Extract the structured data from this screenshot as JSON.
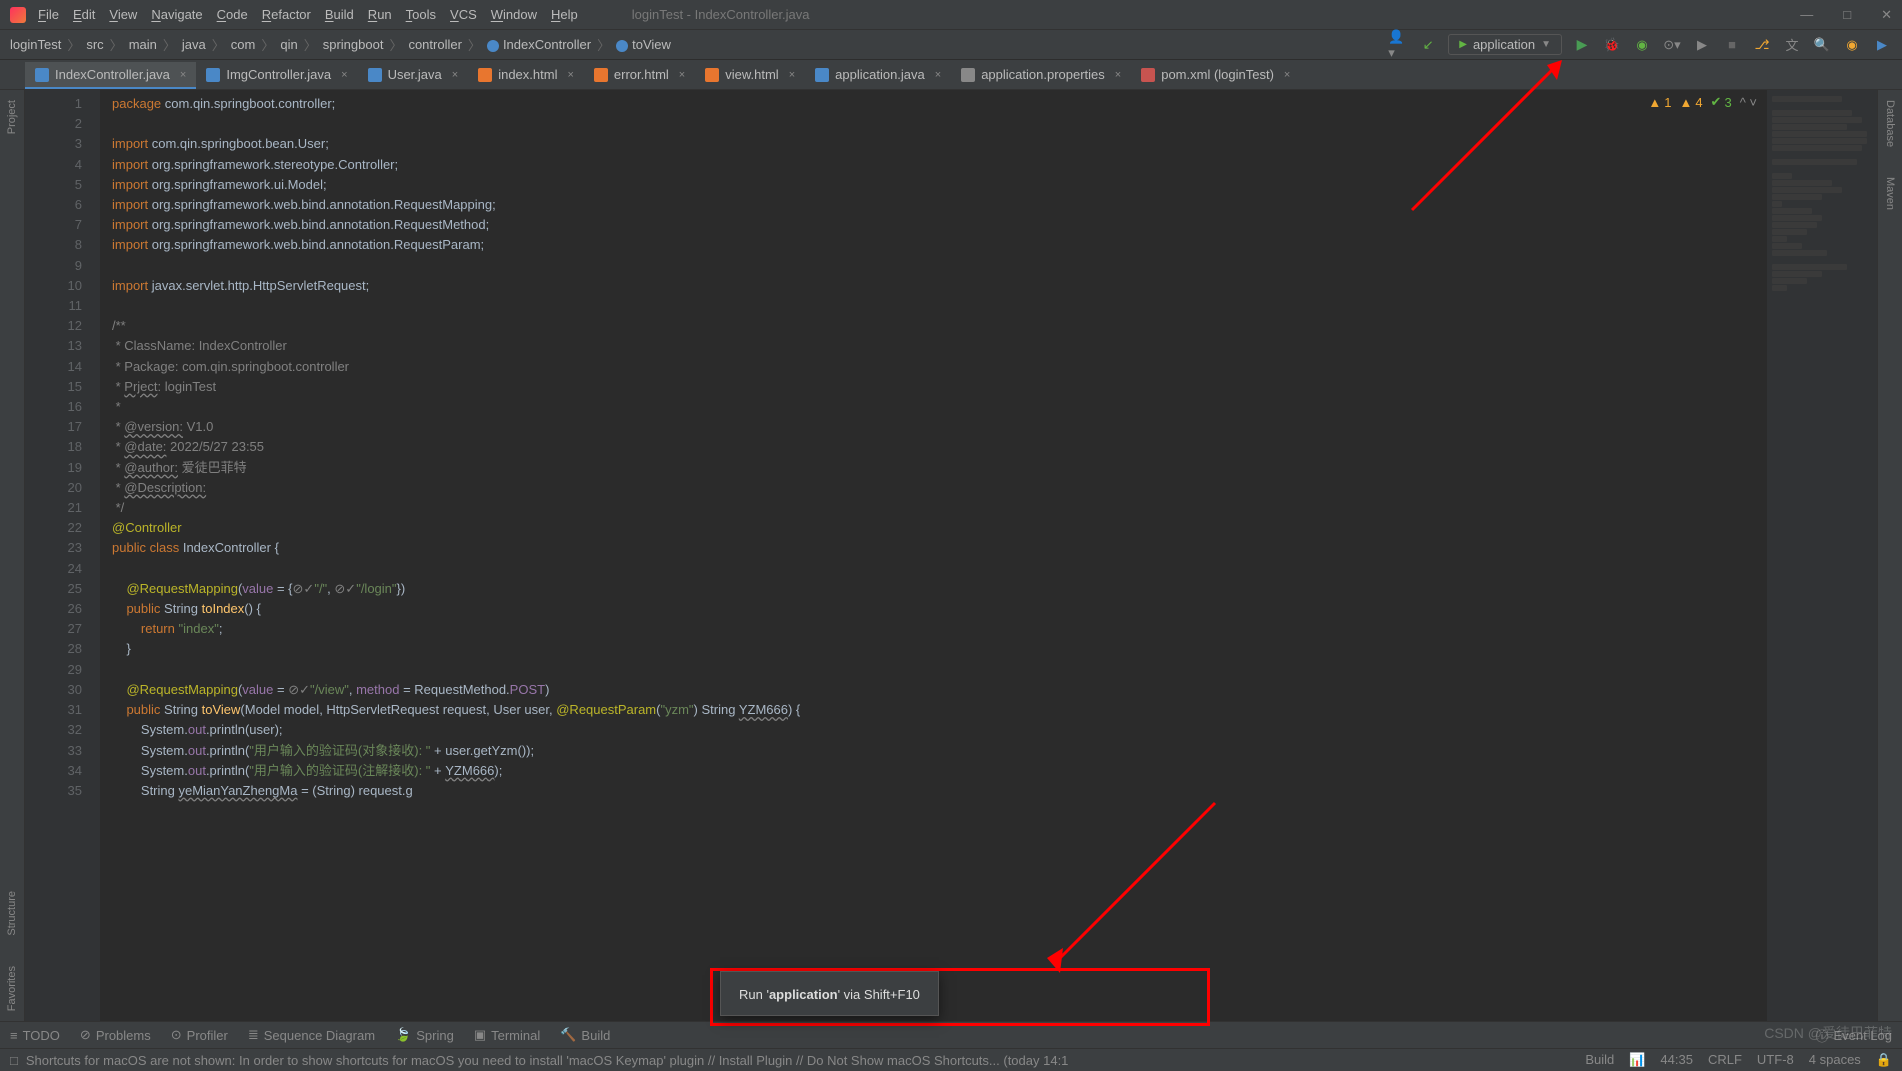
{
  "window_title": "loginTest - IndexController.java",
  "menu": [
    "File",
    "Edit",
    "View",
    "Navigate",
    "Code",
    "Refactor",
    "Build",
    "Run",
    "Tools",
    "VCS",
    "Window",
    "Help"
  ],
  "breadcrumb": [
    "loginTest",
    "src",
    "main",
    "java",
    "com",
    "qin",
    "springboot",
    "controller",
    "IndexController",
    "toView"
  ],
  "run_config": "application",
  "tabs": [
    {
      "label": "IndexController.java",
      "active": true,
      "icon": "c"
    },
    {
      "label": "ImgController.java",
      "icon": "c"
    },
    {
      "label": "User.java",
      "icon": "c"
    },
    {
      "label": "index.html",
      "icon": "h"
    },
    {
      "label": "error.html",
      "icon": "h"
    },
    {
      "label": "view.html",
      "icon": "h"
    },
    {
      "label": "application.java",
      "icon": "c"
    },
    {
      "label": "application.properties",
      "icon": "p"
    },
    {
      "label": "pom.xml (loginTest)",
      "icon": "m"
    }
  ],
  "side_left": [
    "Project"
  ],
  "side_bottom_left": [
    "Structure",
    "Favorites"
  ],
  "side_right": [
    "Database",
    "Maven"
  ],
  "inspections": {
    "w1": "1",
    "w2": "4",
    "ok": "3"
  },
  "lines": 35,
  "tooltip": {
    "pre": "Run '",
    "bold": "application",
    "post": "' via Shift+F10"
  },
  "bottom_tools": [
    "TODO",
    "Problems",
    "Profiler",
    "Sequence Diagram",
    "Spring",
    "Terminal",
    "Build"
  ],
  "status_msg": "Shortcuts for macOS are not shown: In order to show shortcuts for macOS you need to install 'macOS Keymap' plugin // Install Plugin // Do Not Show macOS Shortcuts... (today 14:1",
  "status_right": [
    "Build",
    "44:35",
    "CRLF",
    "UTF-8",
    "4 spaces"
  ],
  "event_log": "Event Log",
  "watermark": "CSDN @爱徒巴菲特",
  "code_lines": [
    {
      "n": 1,
      "html": "<span class='k'>package</span> com.qin.springboot.controller;"
    },
    {
      "n": 2,
      "html": ""
    },
    {
      "n": 3,
      "html": "<span class='k'>import</span> com.qin.springboot.bean.<span class='cn'>User</span>;"
    },
    {
      "n": 4,
      "html": "<span class='k'>import</span> org.springframework.stereotype.<span class='cn'>Controller</span>;"
    },
    {
      "n": 5,
      "html": "<span class='k'>import</span> org.springframework.ui.<span class='cn'>Model</span>;"
    },
    {
      "n": 6,
      "html": "<span class='k'>import</span> org.springframework.web.bind.annotation.<span class='cn'>RequestMapping</span>;"
    },
    {
      "n": 7,
      "html": "<span class='k'>import</span> org.springframework.web.bind.annotation.<span class='cn'>RequestMethod</span>;"
    },
    {
      "n": 8,
      "html": "<span class='k'>import</span> org.springframework.web.bind.annotation.<span class='cn'>RequestParam</span>;"
    },
    {
      "n": 9,
      "html": ""
    },
    {
      "n": 10,
      "html": "<span class='k'>import</span> javax.servlet.http.<span class='cn'>HttpServletRequest</span>;"
    },
    {
      "n": 11,
      "html": ""
    },
    {
      "n": 12,
      "html": "<span class='c'>/**</span>"
    },
    {
      "n": 13,
      "html": "<span class='c'> * ClassName: IndexController</span>"
    },
    {
      "n": 14,
      "html": "<span class='c'> * Package: com.qin.springboot.controller</span>"
    },
    {
      "n": 15,
      "html": "<span class='c'> * <span class='ul'>Prject</span>: loginTest</span>"
    },
    {
      "n": 16,
      "html": "<span class='c'> *</span>"
    },
    {
      "n": 17,
      "html": "<span class='c'> * <span class='ul'>@version:</span> V1.0</span>"
    },
    {
      "n": 18,
      "html": "<span class='c'> * <span class='ul'>@date:</span> 2022/5/27 23:55</span>"
    },
    {
      "n": 19,
      "html": "<span class='c'> * <span class='ul'>@author:</span> 爱徒巴菲特</span>"
    },
    {
      "n": 20,
      "html": "<span class='c'> * <span class='ul'>@Description:</span></span>"
    },
    {
      "n": 21,
      "html": "<span class='c'> */</span>"
    },
    {
      "n": 22,
      "html": "<span class='a'>@Controller</span>"
    },
    {
      "n": 23,
      "html": "<span class='k'>public class</span> <span class='cn'>IndexController</span> {"
    },
    {
      "n": 24,
      "html": ""
    },
    {
      "n": 25,
      "html": "    <span class='a'>@RequestMapping</span>(<span class='p'>value</span> = {<span class='c'>⊘✓</span><span class='s'>\"/\"</span>, <span class='c'>⊘✓</span><span class='s'>\"/login\"</span>})"
    },
    {
      "n": 26,
      "html": "    <span class='k'>public</span> String <span class='f'>toIndex</span>() {"
    },
    {
      "n": 27,
      "html": "        <span class='k'>return</span> <span class='s'>\"index\"</span>;"
    },
    {
      "n": 28,
      "html": "    }"
    },
    {
      "n": 29,
      "html": ""
    },
    {
      "n": 30,
      "html": "    <span class='a'>@RequestMapping</span>(<span class='p'>value</span> = <span class='c'>⊘✓</span><span class='s'>\"/view\"</span>, <span class='p'>method</span> = RequestMethod.<span class='p'>POST</span>)"
    },
    {
      "n": 31,
      "html": "    <span class='k'>public</span> String <span class='f'>toView</span>(Model <span class='cn'>model</span>, HttpServletRequest <span class='cn'>request</span>, User <span class='cn'>user</span>, <span class='a'>@RequestParam</span>(<span class='s'>\"yzm\"</span>) String <span class='cn ul'>YZM666</span>) {"
    },
    {
      "n": 32,
      "html": "        System.<span class='p'>out</span>.println(user);"
    },
    {
      "n": 33,
      "html": "        System.<span class='p'>out</span>.println(<span class='s'>\"用户输入的验证码(对象接收): \"</span> + user.getYzm());"
    },
    {
      "n": 34,
      "html": "        System.<span class='p'>out</span>.println(<span class='s'>\"用户输入的验证码(注解接收): \"</span> + <span class='ul'>YZM666</span>);"
    },
    {
      "n": 35,
      "html": "        String <span class='ul'>yeMianYanZhengMa</span> = (String) request.g"
    }
  ]
}
